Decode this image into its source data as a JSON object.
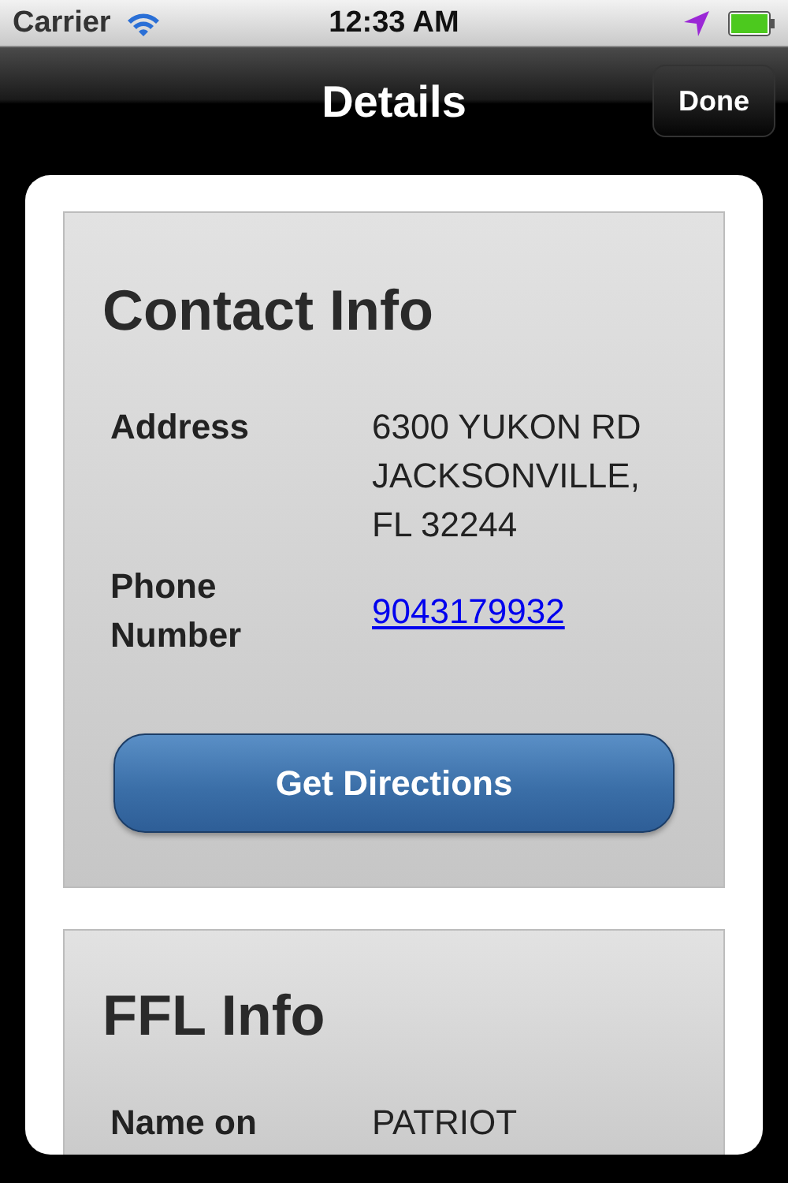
{
  "status_bar": {
    "carrier": "Carrier",
    "time": "12:33 AM"
  },
  "nav_bar": {
    "title": "Details",
    "done_button": "Done"
  },
  "sections": [
    {
      "title": "Contact Info",
      "rows": [
        {
          "kind": "text",
          "label": "Address",
          "value": "6300 YUKON RD JACKSONVILLE, FL 32244"
        },
        {
          "kind": "link",
          "label": "Phone Number",
          "value": "9043179932"
        }
      ],
      "button": "Get Directions"
    },
    {
      "title": "FFL Info",
      "rows": [
        {
          "kind": "text",
          "label": "Name on",
          "value": "PATRIOT"
        }
      ]
    }
  ]
}
